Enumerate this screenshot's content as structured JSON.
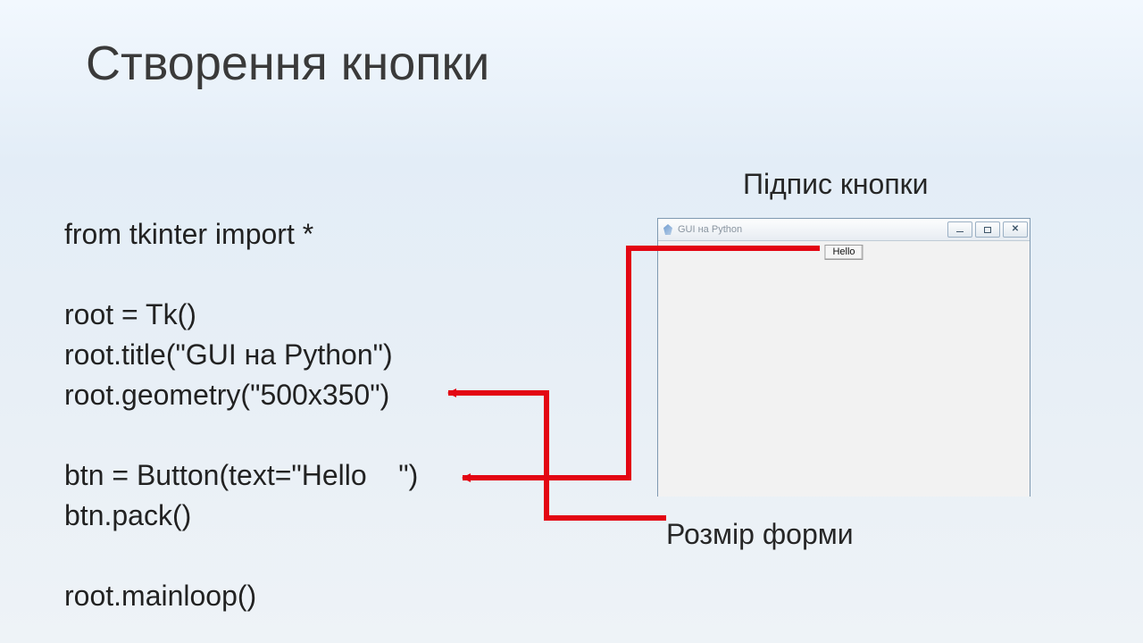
{
  "title": "Створення кнопки",
  "code": "from tkinter import *\n\nroot = Tk()\nroot.title(\"GUI на Python\")\nroot.geometry(\"500x350\")\n\nbtn = Button(text=\"Hello    \")\nbtn.pack()\n\nroot.mainloop()",
  "labels": {
    "button_caption": "Підпис кнопки",
    "form_size": "Розмір форми"
  },
  "tk_window": {
    "title": "GUI на Python",
    "button_text": "Hello"
  }
}
